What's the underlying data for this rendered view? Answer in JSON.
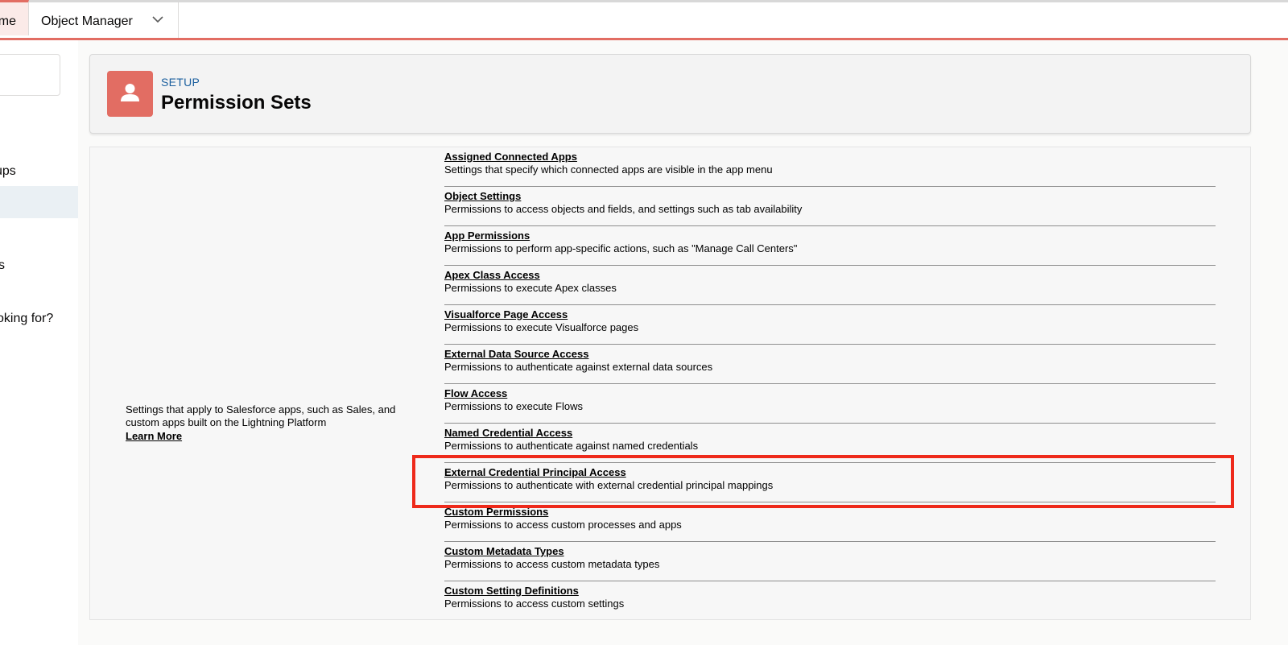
{
  "nav": {
    "home_label": "Home",
    "object_manager_label": "Object Manager"
  },
  "sidebar": {
    "items": [
      {
        "label": "ups"
      },
      {
        "label": "s"
      },
      {
        "label": "oking for?"
      }
    ]
  },
  "header": {
    "eyebrow": "SETUP",
    "title": "Permission Sets"
  },
  "section": {
    "description": "Settings that apply to Salesforce apps, such as Sales, and custom apps built on the Lightning Platform",
    "learn_more": "Learn More"
  },
  "permissions": [
    {
      "title": "Assigned Connected Apps",
      "desc": "Settings that specify which connected apps are visible in the app menu"
    },
    {
      "title": "Object Settings",
      "desc": "Permissions to access objects and fields, and settings such as tab availability"
    },
    {
      "title": "App Permissions",
      "desc": "Permissions to perform app-specific actions, such as \"Manage Call Centers\""
    },
    {
      "title": "Apex Class Access",
      "desc": "Permissions to execute Apex classes"
    },
    {
      "title": "Visualforce Page Access",
      "desc": "Permissions to execute Visualforce pages"
    },
    {
      "title": "External Data Source Access",
      "desc": "Permissions to authenticate against external data sources"
    },
    {
      "title": "Flow Access",
      "desc": "Permissions to execute Flows"
    },
    {
      "title": "Named Credential Access",
      "desc": "Permissions to authenticate against named credentials"
    },
    {
      "title": "External Credential Principal Access",
      "desc": "Permissions to authenticate with external credential principal mappings"
    },
    {
      "title": "Custom Permissions",
      "desc": "Permissions to access custom processes and apps"
    },
    {
      "title": "Custom Metadata Types",
      "desc": "Permissions to access custom metadata types"
    },
    {
      "title": "Custom Setting Definitions",
      "desc": "Permissions to access custom settings"
    }
  ],
  "colors": {
    "brand": "#e26d63",
    "highlight": "#ee2a1b",
    "link": "#1b5f9e"
  },
  "icons": {
    "header": "user-icon",
    "tab_menu": "chevron-down-icon"
  }
}
